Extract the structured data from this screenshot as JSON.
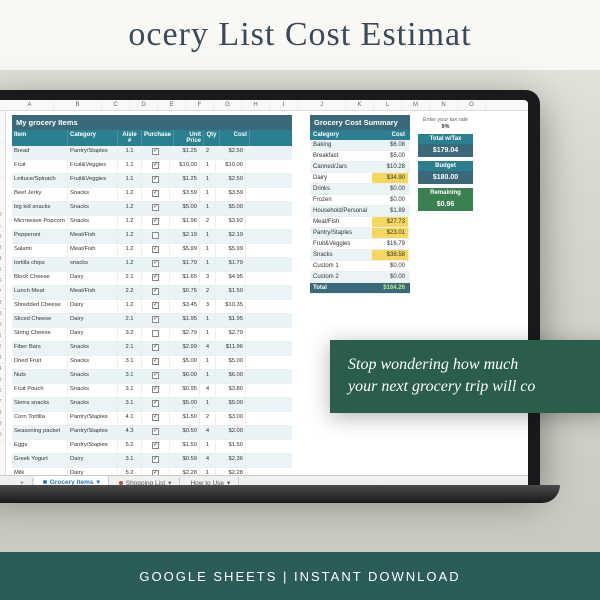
{
  "banner_title": "ocery List Cost Estimat",
  "footer_text": "GOOGLE SHEETS  |  INSTANT DOWNLOAD",
  "callout_line1": "Stop wondering how much",
  "callout_line2": "your next grocery trip will co",
  "columns": [
    "A",
    "B",
    "C",
    "D",
    "E",
    "F",
    "G",
    "H",
    "I",
    "J",
    "K",
    "L",
    "M",
    "N",
    "O"
  ],
  "list_title": "My grocery Items",
  "summary_title": "Grocery Cost Summary",
  "headers": {
    "item": "Item",
    "category": "Category",
    "aisle": "Aisle #",
    "purchase": "Purchase",
    "unit": "Unit Price",
    "qty": "Qty",
    "cost": "Cost"
  },
  "rows": [
    {
      "n": 5,
      "item": "Bread",
      "cat": "Pantry/Staples",
      "aisle": "1.1",
      "chk": true,
      "price": "$1.25",
      "qty": 2,
      "cost": "$2.50"
    },
    {
      "n": 6,
      "item": "Fruit",
      "cat": "Fruit&Veggies",
      "aisle": "1.1",
      "chk": true,
      "price": "$10.00",
      "qty": 1,
      "cost": "$10.00"
    },
    {
      "n": 7,
      "item": "Lettuce/Spinach",
      "cat": "Fruit&Veggies",
      "aisle": "1.1",
      "chk": true,
      "price": "$1.25",
      "qty": 1,
      "cost": "$2.50"
    },
    {
      "n": 8,
      "item": "Beef Jerky",
      "cat": "Snacks",
      "aisle": "1.2",
      "chk": true,
      "price": "$3.59",
      "qty": 1,
      "cost": "$3.59"
    },
    {
      "n": 9,
      "item": "big kid snacks",
      "cat": "Snacks",
      "aisle": "1.2",
      "chk": true,
      "price": "$5.00",
      "qty": 1,
      "cost": "$5.00"
    },
    {
      "n": 10,
      "item": "Microwave Popcorn",
      "cat": "Snacks",
      "aisle": "1.2",
      "chk": true,
      "price": "$1.96",
      "qty": 2,
      "cost": "$3.92"
    },
    {
      "n": 11,
      "item": "Pepperoni",
      "cat": "Meat/Fish",
      "aisle": "1.2",
      "chk": false,
      "price": "$2.19",
      "qty": 1,
      "cost": "$2.19"
    },
    {
      "n": 12,
      "item": "Salami",
      "cat": "Meat/Fish",
      "aisle": "1.2",
      "chk": true,
      "price": "$5.99",
      "qty": 1,
      "cost": "$5.99"
    },
    {
      "n": 13,
      "item": "tortilla chips",
      "cat": "snacks",
      "aisle": "1.2",
      "chk": true,
      "price": "$1.79",
      "qty": 1,
      "cost": "$1.79"
    },
    {
      "n": 14,
      "item": "Block Cheese",
      "cat": "Dairy",
      "aisle": "2.1",
      "chk": true,
      "price": "$1.65",
      "qty": 3,
      "cost": "$4.95"
    },
    {
      "n": 15,
      "item": "Lunch Meat",
      "cat": "Meat/Fish",
      "aisle": "2.2",
      "chk": true,
      "price": "$0.75",
      "qty": 2,
      "cost": "$1.50"
    },
    {
      "n": 16,
      "item": "Shredded Cheese",
      "cat": "Dairy",
      "aisle": "1.2",
      "chk": true,
      "price": "$3.45",
      "qty": 3,
      "cost": "$10.35"
    },
    {
      "n": 17,
      "item": "Sliced Cheese",
      "cat": "Dairy",
      "aisle": "2.1",
      "chk": true,
      "price": "$1.95",
      "qty": 1,
      "cost": "$1.95"
    },
    {
      "n": 18,
      "item": "String Cheese",
      "cat": "Dairy",
      "aisle": "3.2",
      "chk": false,
      "price": "$2.79",
      "qty": 1,
      "cost": "$2.79"
    },
    {
      "n": 19,
      "item": "Fiber Bars",
      "cat": "Snacks",
      "aisle": "2.1",
      "chk": true,
      "price": "$2.99",
      "qty": 4,
      "cost": "$11.96"
    },
    {
      "n": 20,
      "item": "Dried Fruit",
      "cat": "Snacks",
      "aisle": "3.1",
      "chk": true,
      "price": "$5.00",
      "qty": 1,
      "cost": "$5.00"
    },
    {
      "n": 21,
      "item": "Nuts",
      "cat": "Snacks",
      "aisle": "3.1",
      "chk": true,
      "price": "$6.00",
      "qty": 1,
      "cost": "$6.00"
    },
    {
      "n": 22,
      "item": "Fruit Pouch",
      "cat": "Snacks",
      "aisle": "3.1",
      "chk": true,
      "price": "$0.95",
      "qty": 4,
      "cost": "$3.80"
    },
    {
      "n": 23,
      "item": "Sierra snacks",
      "cat": "Snacks",
      "aisle": "3.1",
      "chk": true,
      "price": "$5.00",
      "qty": 1,
      "cost": "$5.00"
    },
    {
      "n": 24,
      "item": "Corn Tortilla",
      "cat": "Pantry/Staples",
      "aisle": "4.1",
      "chk": true,
      "price": "$1.50",
      "qty": 2,
      "cost": "$3.00"
    },
    {
      "n": 25,
      "item": "Seasoning packet",
      "cat": "Pantry/Staples",
      "aisle": "4.3",
      "chk": true,
      "price": "$0.50",
      "qty": 4,
      "cost": "$2.00"
    },
    {
      "n": 26,
      "item": "Eggs",
      "cat": "Pantry/Staples",
      "aisle": "5.2",
      "chk": true,
      "price": "$1.50",
      "qty": 1,
      "cost": "$1.50"
    },
    {
      "n": 27,
      "item": "Greek Yogurt",
      "cat": "Dairy",
      "aisle": "3.1",
      "chk": true,
      "price": "$0.59",
      "qty": 4,
      "cost": "$2.36"
    },
    {
      "n": 28,
      "item": "Milk",
      "cat": "Dairy",
      "aisle": "5.2",
      "chk": true,
      "price": "$2.28",
      "qty": 1,
      "cost": "$2.28"
    }
  ],
  "summary_headers": {
    "cat": "Category",
    "cost": "Cost"
  },
  "summary": [
    {
      "cat": "Baking",
      "cost": "$6.08"
    },
    {
      "cat": "Breakfast",
      "cost": "$5.00"
    },
    {
      "cat": "Canned/Jars",
      "cost": "$10.28"
    },
    {
      "cat": "Dairy",
      "cost": "$34.90",
      "hl": true
    },
    {
      "cat": "Drinks",
      "cost": "$0.00"
    },
    {
      "cat": "Frozen",
      "cost": "$0.00"
    },
    {
      "cat": "Household/Personal",
      "cost": "$1.89"
    },
    {
      "cat": "Meat/Fish",
      "cost": "$27.73",
      "hl": true
    },
    {
      "cat": "Pantry/Staples",
      "cost": "$23.01",
      "hl": true
    },
    {
      "cat": "Fruit&Veggies",
      "cost": "$16.79"
    },
    {
      "cat": "Snacks",
      "cost": "$38.58",
      "hl": true
    },
    {
      "cat": "Custom 1",
      "cost": "$0.00"
    },
    {
      "cat": "Custom 2",
      "cost": "$0.00"
    }
  ],
  "summary_total": {
    "label": "Total",
    "value": "$164.26"
  },
  "tax": {
    "label": "Enter your tax rate",
    "value": "9%"
  },
  "total_tax": {
    "label": "Total w/Tax",
    "value": "$179.04"
  },
  "budget": {
    "label": "Budget",
    "value": "$180.00"
  },
  "remaining": {
    "label": "Remaining",
    "value": "$0.96"
  },
  "tabs": {
    "plus": "+",
    "t1": "Grocery Items",
    "t2": "Shopping List",
    "t3": "How to Use"
  }
}
